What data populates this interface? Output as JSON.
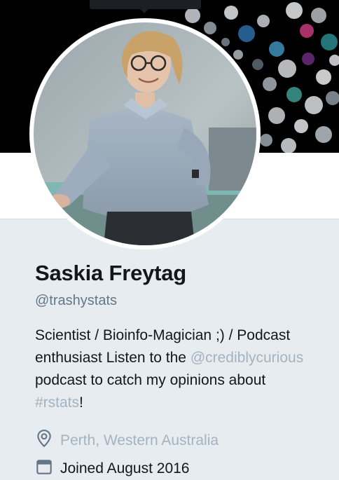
{
  "profile": {
    "name": "Saskia Freytag",
    "handle": "@trashystats",
    "bio": {
      "line1": "Scientist / Bioinfo-Magician ;) / Podcast",
      "line2_text": "enthusiast Listen to the ",
      "line2_mention": "@crediblycurious",
      "line3": "podcast to catch my opinions about",
      "line4_hashtag": "#rstats",
      "line4_end": "!"
    },
    "location": "Perth, Western Australia",
    "joined": "Joined August 2016"
  },
  "icons": {
    "location": "map-pin-icon",
    "joined": "calendar-icon"
  },
  "colors": {
    "background": "#e6ecf0",
    "secondary_text": "#657786",
    "link": "#a4b3c0",
    "primary_text": "#14171a"
  }
}
